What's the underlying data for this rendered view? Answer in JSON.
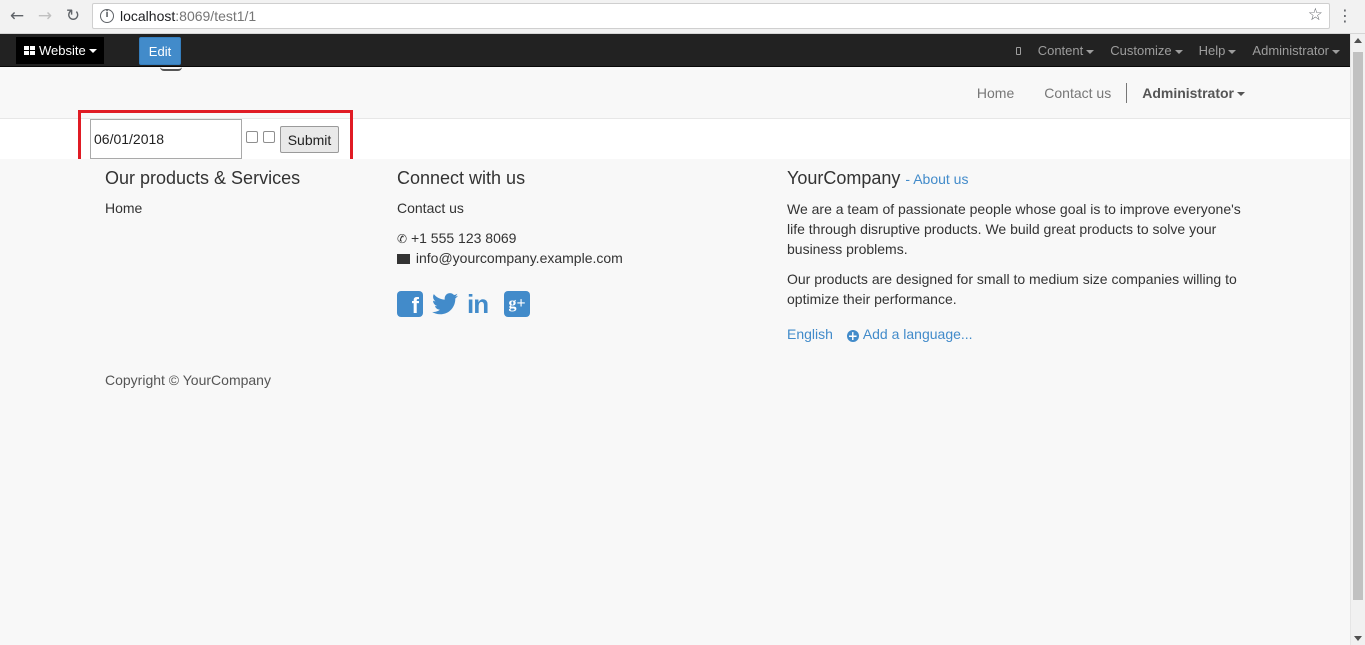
{
  "browser": {
    "url_host": "localhost",
    "url_rest": ":8069/test1/1"
  },
  "topbar": {
    "website_label": "Website",
    "edit_label": "Edit",
    "content_label": "Content",
    "customize_label": "Customize",
    "help_label": "Help",
    "admin_label": "Administrator"
  },
  "site_nav": {
    "home": "Home",
    "contact": "Contact us",
    "admin": "Administrator"
  },
  "form": {
    "date_value": "06/01/2018",
    "submit_label": "Submit"
  },
  "footer": {
    "products_title": "Our products & Services",
    "products_home": "Home",
    "connect_title": "Connect with us",
    "connect_contact": "Contact us",
    "phone": "+1 555 123 8069",
    "email": "info@yourcompany.example.com",
    "company_title": "YourCompany",
    "about_link": "- About us",
    "about_p1": "We are a team of passionate people whose goal is to improve everyone's life through disruptive products. We build great products to solve your business problems.",
    "about_p2": "Our products are designed for small to medium size companies willing to optimize their performance.",
    "lang_current": "English",
    "lang_add": "Add a language...",
    "copyright": "Copyright © YourCompany"
  },
  "colors": {
    "link": "#428bca",
    "highlight": "#e01b24",
    "topbar": "#222222"
  }
}
